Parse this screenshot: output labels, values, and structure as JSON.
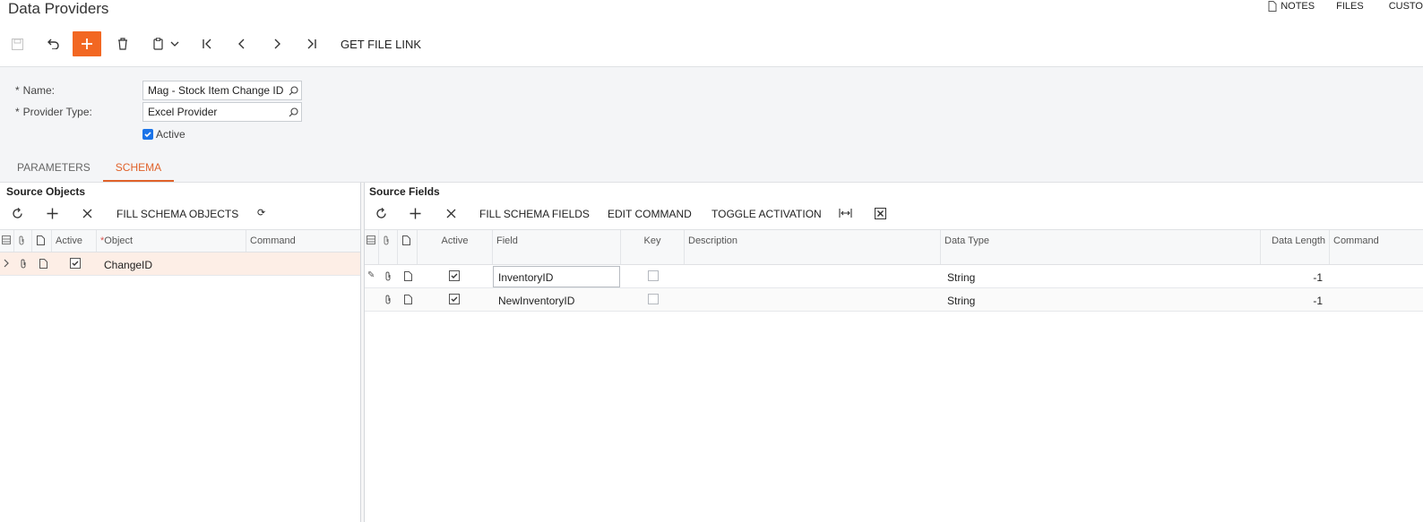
{
  "header": {
    "title": "Data Providers",
    "links": [
      "NOTES",
      "FILES",
      "CUSTO"
    ]
  },
  "toolbar": {
    "get_file_link": "GET FILE LINK",
    "accent_color": "#f26722"
  },
  "form": {
    "name_label": "Name:",
    "name_value": "Mag - Stock Item Change ID",
    "provider_type_label": "Provider Type:",
    "provider_type_value": "Excel Provider",
    "active_label": "Active",
    "active_checked": true,
    "required_marker": "*"
  },
  "tabs": [
    {
      "label": "PARAMETERS",
      "active": false
    },
    {
      "label": "SCHEMA",
      "active": true
    }
  ],
  "source_objects": {
    "title": "Source Objects",
    "fill_button": "FILL SCHEMA OBJECTS",
    "columns": [
      "Active",
      "Object",
      "Command"
    ],
    "required_marker": "*",
    "rows": [
      {
        "active": true,
        "object": "ChangeID",
        "command": ""
      }
    ]
  },
  "source_fields": {
    "title": "Source Fields",
    "buttons": [
      "FILL SCHEMA FIELDS",
      "EDIT COMMAND",
      "TOGGLE ACTIVATION"
    ],
    "columns": [
      "Active",
      "Field",
      "Key",
      "Description",
      "Data Type",
      "Data Length",
      "Command"
    ],
    "rows": [
      {
        "active": true,
        "field": "InventoryID",
        "key": false,
        "description": "",
        "data_type": "String",
        "data_length": "-1",
        "command": ""
      },
      {
        "active": true,
        "field": "NewInventoryID",
        "key": false,
        "description": "",
        "data_type": "String",
        "data_length": "-1",
        "command": ""
      }
    ]
  }
}
